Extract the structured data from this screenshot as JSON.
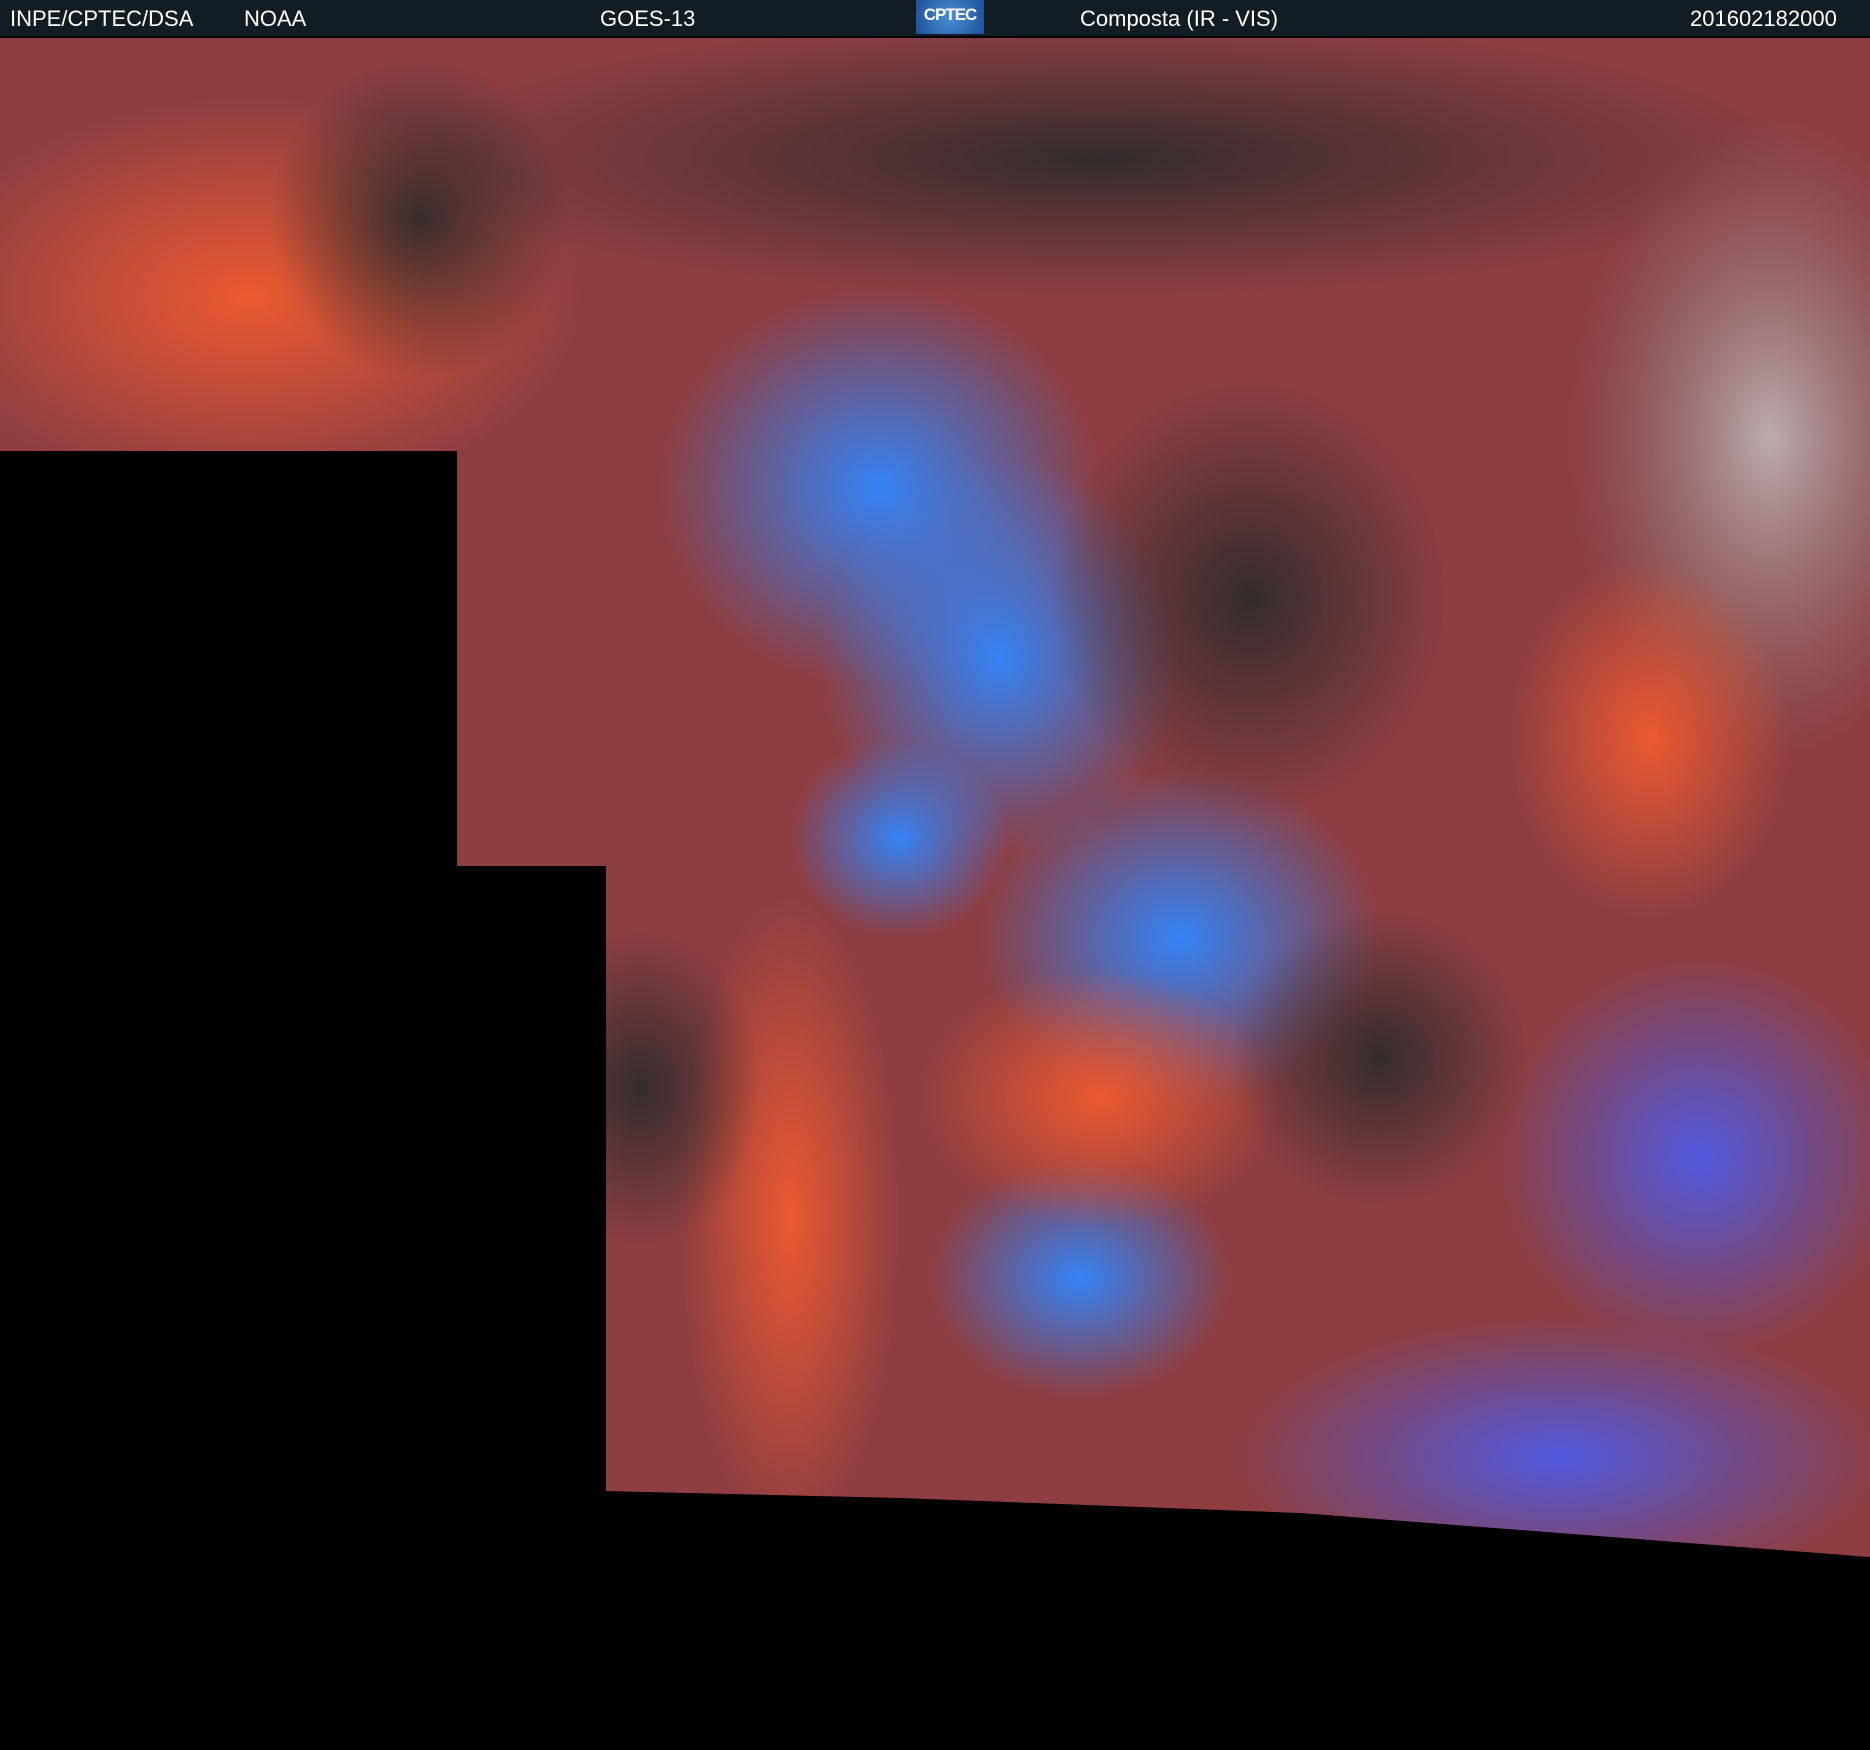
{
  "header": {
    "institution": "INPE/CPTEC/DSA",
    "agency": "NOAA",
    "satellite": "GOES-13",
    "logo_text": "CPTEC",
    "product": "Composta (IR - VIS)",
    "timestamp": "201602182000"
  },
  "colors": {
    "header_bg": "#111c24",
    "cold_cloud": "#2f7bff",
    "warm_cloud": "#e0503a",
    "land": "#2b2b2b",
    "nodata": "#000000"
  }
}
